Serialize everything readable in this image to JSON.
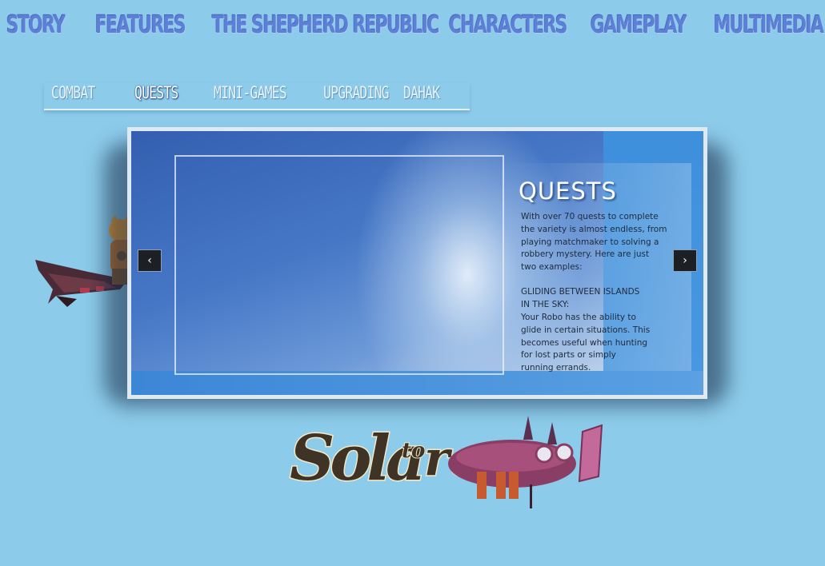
{
  "topnav": {
    "items": [
      {
        "label": "Story"
      },
      {
        "label": "Features"
      },
      {
        "label": "The Shepherd Republic"
      },
      {
        "label": "Characters"
      },
      {
        "label": "Gameplay"
      },
      {
        "label": "Multimedia"
      }
    ]
  },
  "subnav": {
    "tabs": [
      {
        "label": "Combat"
      },
      {
        "label": "Quests"
      },
      {
        "label": "Mini-Games"
      },
      {
        "label": "Upgrading  Dahak"
      }
    ],
    "active": "Quests"
  },
  "slide": {
    "title": "QUESTS",
    "intro_lines": [
      "With over 70 quests to complete",
      "the variety is almost endless, from",
      "playing matchmaker to solving a",
      "robbery mystery. Here are just",
      "two examples:"
    ],
    "subheading_lines": [
      "GLIDING BETWEEN ISLANDS",
      "IN THE SKY:"
    ],
    "body_lines": [
      "Your Robo has the ability to",
      "glide in certain situations. This",
      "becomes useful when hunting",
      "for lost parts or simply",
      "running errands."
    ]
  },
  "controls": {
    "prev_arrow": "‹",
    "next_arrow": "›"
  },
  "logo": {
    "text": "Solatorobo",
    "subtext": "to"
  },
  "colors": {
    "background": "#8ccbea",
    "nav_text": "#5b80d6",
    "slide_blue": "#3f7fcf"
  }
}
